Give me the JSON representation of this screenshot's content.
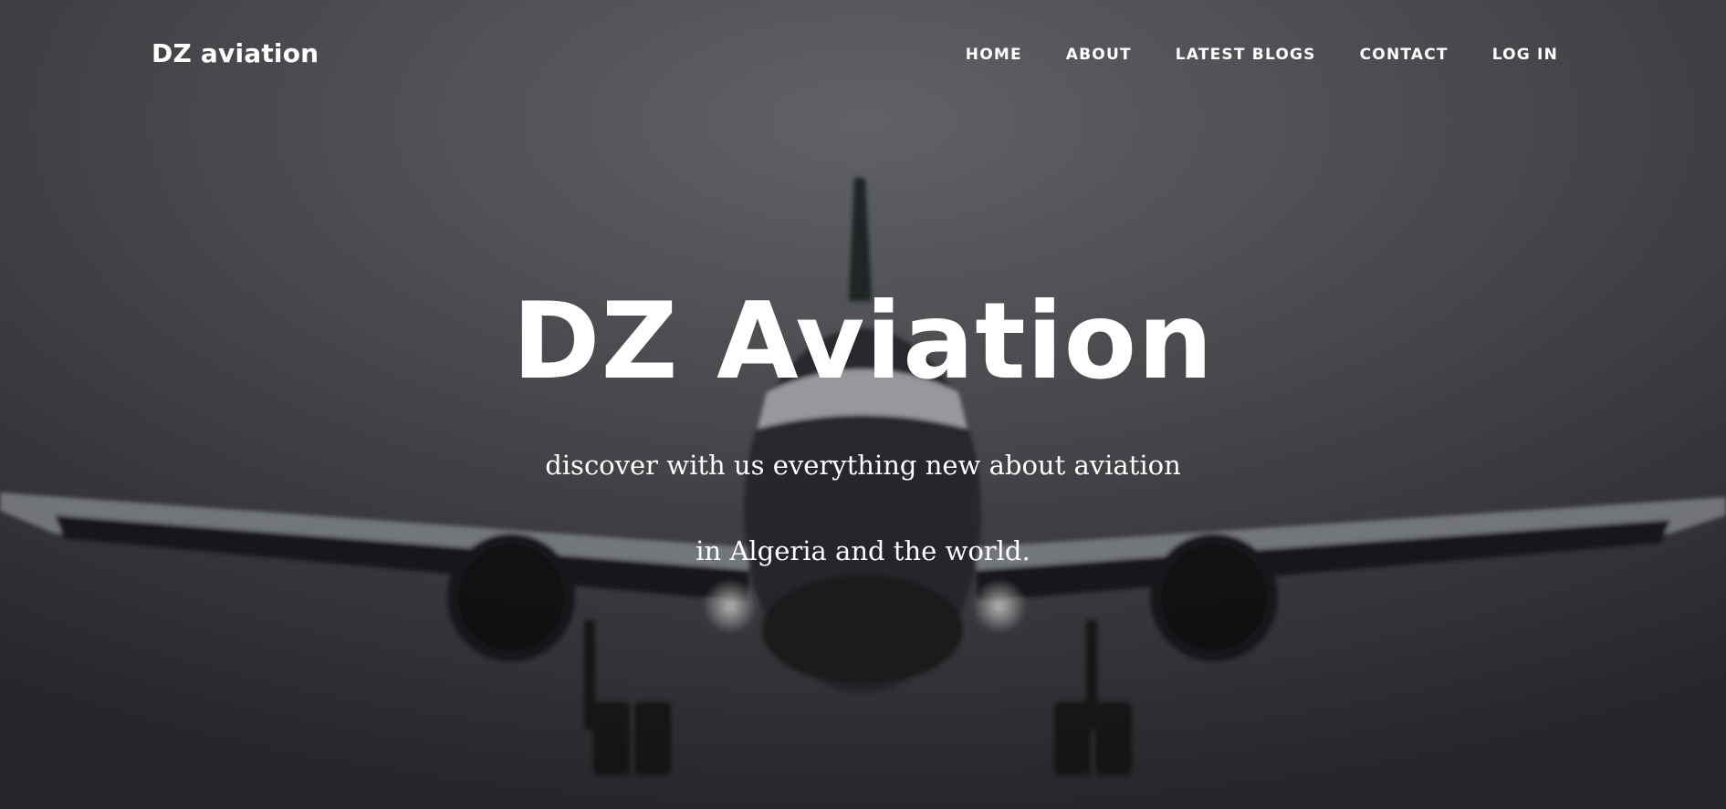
{
  "brand": {
    "name": "DZ aviation"
  },
  "nav": {
    "items": [
      {
        "label": "HOME"
      },
      {
        "label": "ABOUT"
      },
      {
        "label": "LATEST BLOGS"
      },
      {
        "label": "CONTACT"
      },
      {
        "label": "LOG IN"
      }
    ]
  },
  "hero": {
    "title": "DZ Aviation",
    "subtitle_line1": "discover with us everything new about aviation",
    "subtitle_line2": "in Algeria and the world."
  },
  "colors": {
    "text": "#ffffff",
    "background": "#4a4c50"
  }
}
